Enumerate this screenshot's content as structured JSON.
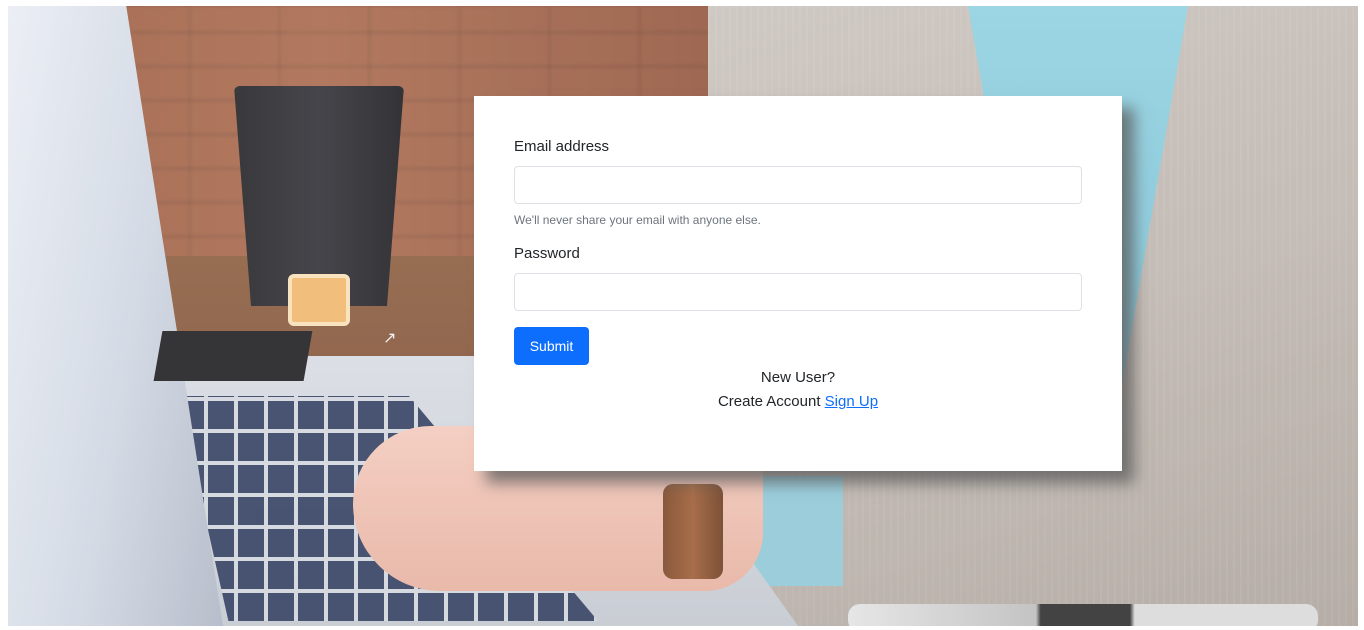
{
  "login_form": {
    "email": {
      "label": "Email address",
      "value": "",
      "placeholder": "",
      "help_text": "We'll never share your email with anyone else."
    },
    "password": {
      "label": "Password",
      "value": "",
      "placeholder": ""
    },
    "submit_label": "Submit"
  },
  "signup": {
    "prompt": "New User?",
    "create_text": "Create Account",
    "link_label": "Sign Up"
  },
  "colors": {
    "primary": "#0d6efd",
    "card_background": "#ffffff",
    "help_text": "#6c757d"
  },
  "icons": {
    "cursor": "mouse-pointer-icon"
  }
}
